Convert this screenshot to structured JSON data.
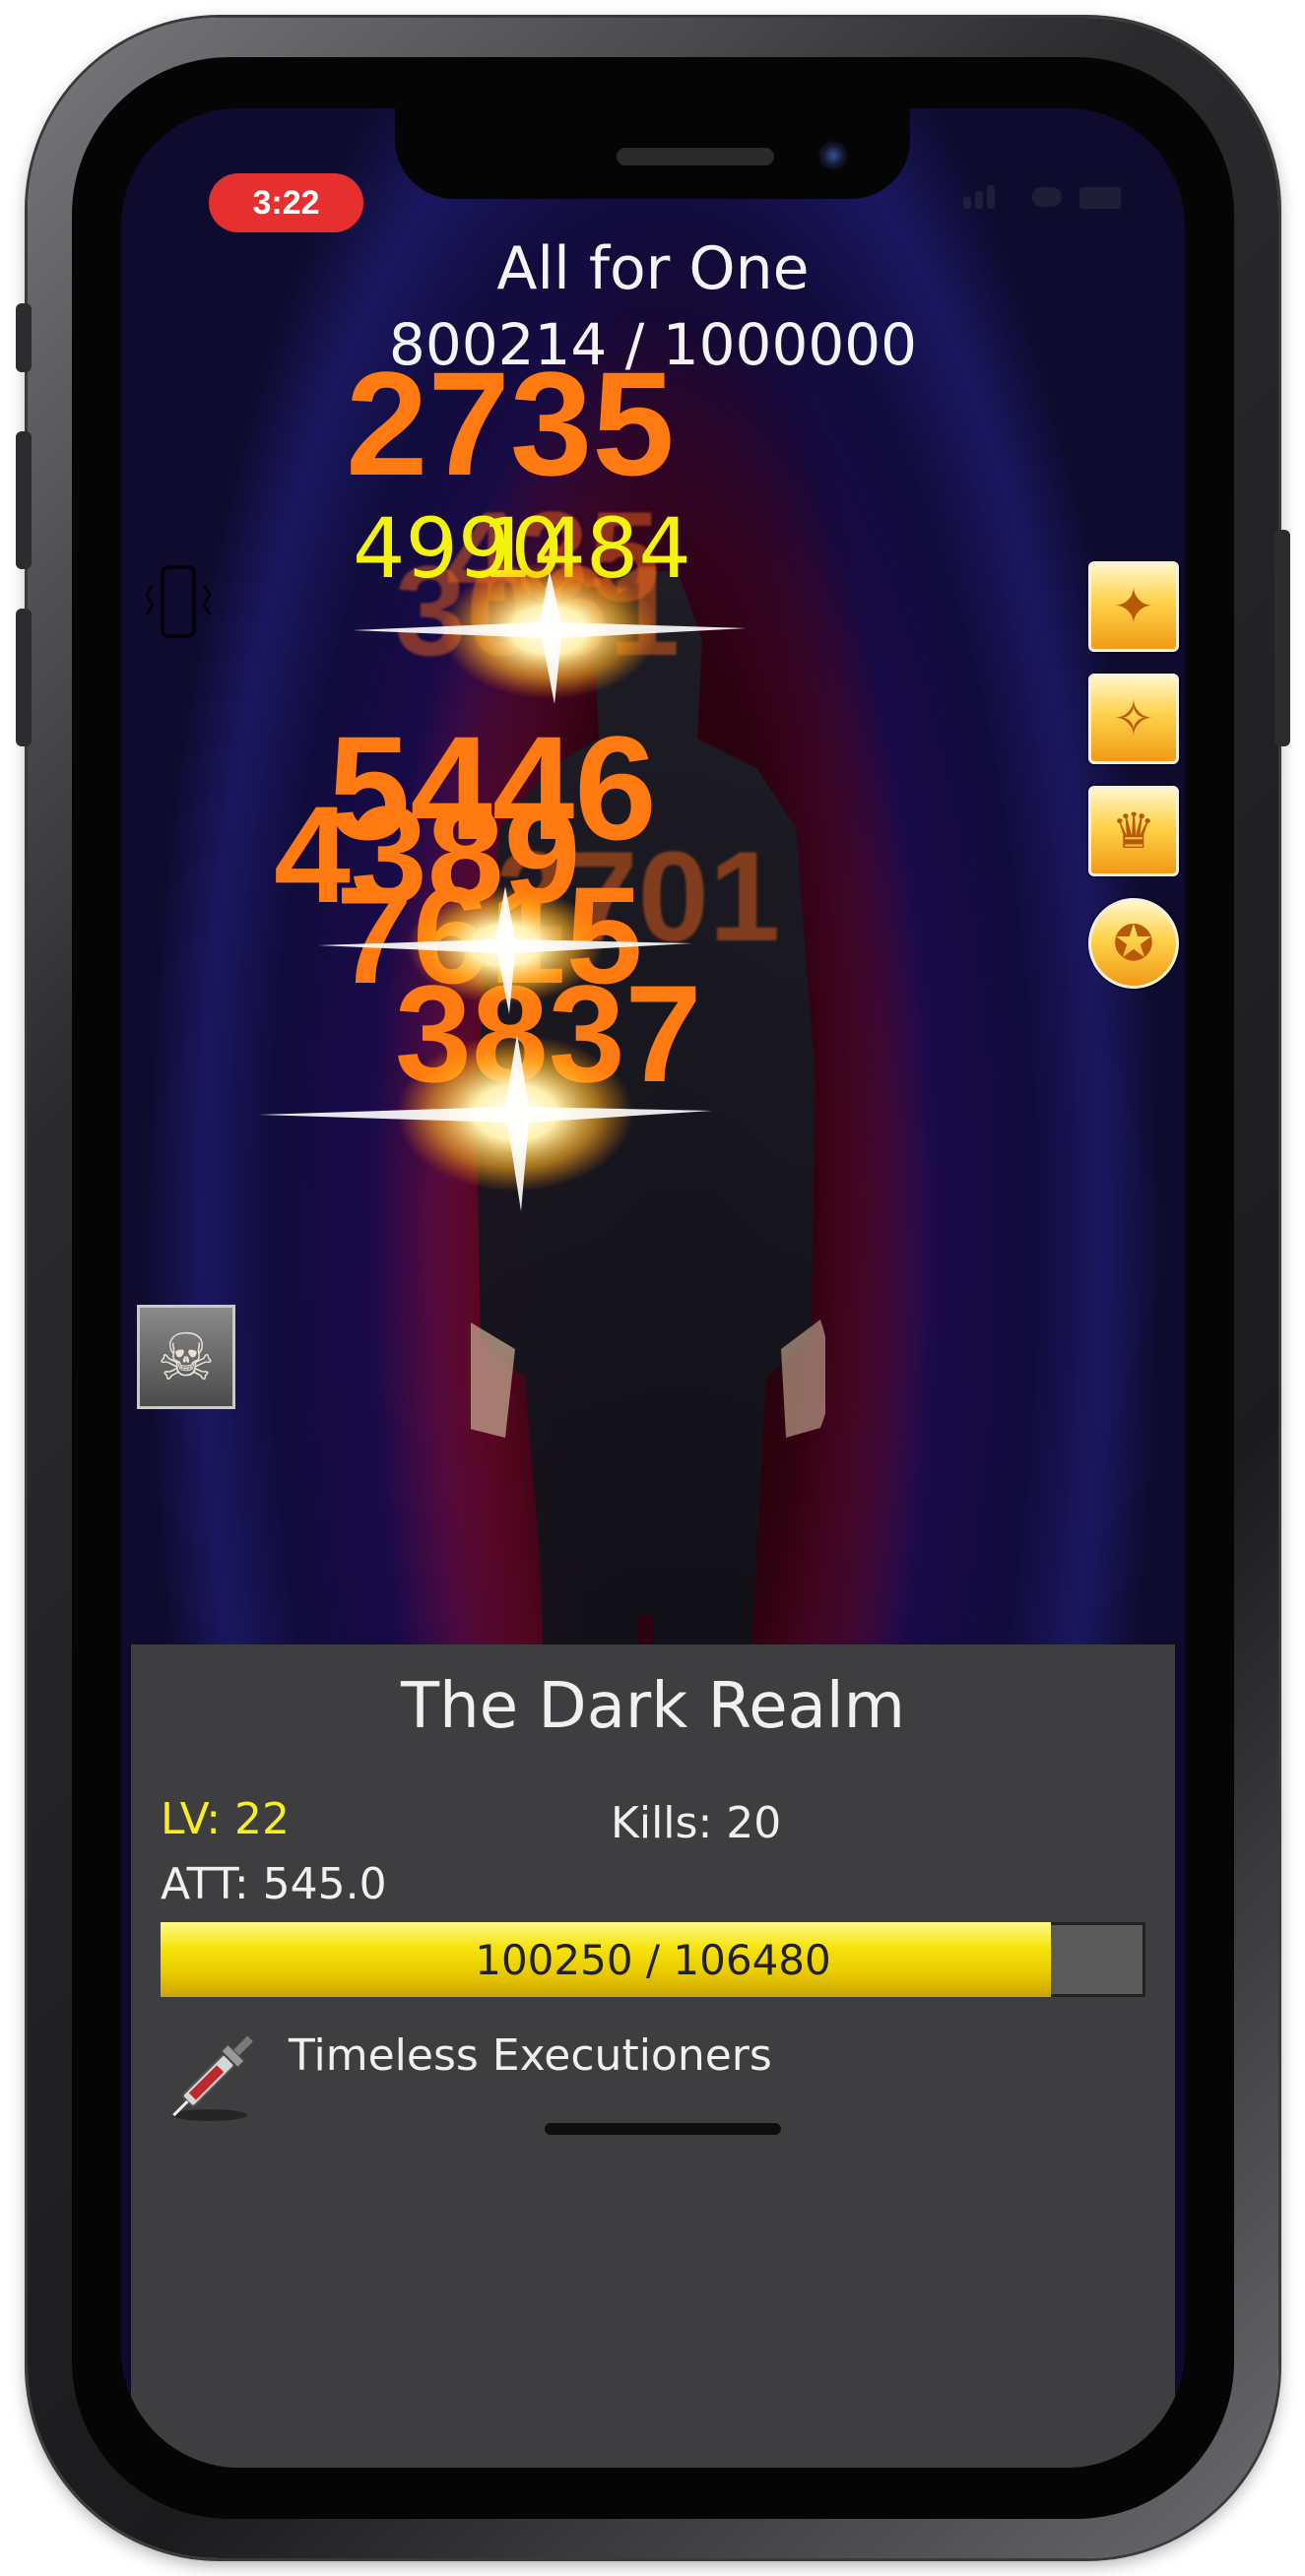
{
  "status_bar": {
    "time": "3:22"
  },
  "boss": {
    "name": "All for One",
    "hp_text": "800214 / 1000000",
    "hp_current": 800214,
    "hp_max": 1000000
  },
  "damage_numbers": {
    "d1": "2735",
    "d2": "4990",
    "d3": "1484",
    "d4": "3061",
    "d5": "5446",
    "d6": "4389",
    "d7": "7615",
    "d8": "3837",
    "d9": "2701",
    "d10": "435"
  },
  "skills": [
    {
      "icon": "winged-crest-icon"
    },
    {
      "icon": "eagle-crest-icon"
    },
    {
      "icon": "golden-statue-icon"
    },
    {
      "icon": "attack-up-icon"
    }
  ],
  "side_icons": {
    "left_top": "vibrate-phone-icon",
    "left_bottom": "skull-icon"
  },
  "panel": {
    "realm": "The Dark Realm",
    "level": "LV: 22",
    "kills": "Kills: 20",
    "attack": "ATT: 545.0",
    "xp_text": "100250 / 106480",
    "xp_current": 100250,
    "xp_max": 106480,
    "guild": "Timeless Executioners",
    "guild_icon": "syringe-weapon-icon"
  },
  "colors": {
    "damage_orange": "#ff7a10",
    "damage_yellow": "#f4f30e",
    "level_yellow": "#f6ee21",
    "xp_bar_yellow": "#f6e30a",
    "panel_bg": "#3e3e40",
    "time_pill_red": "#e6302f"
  }
}
